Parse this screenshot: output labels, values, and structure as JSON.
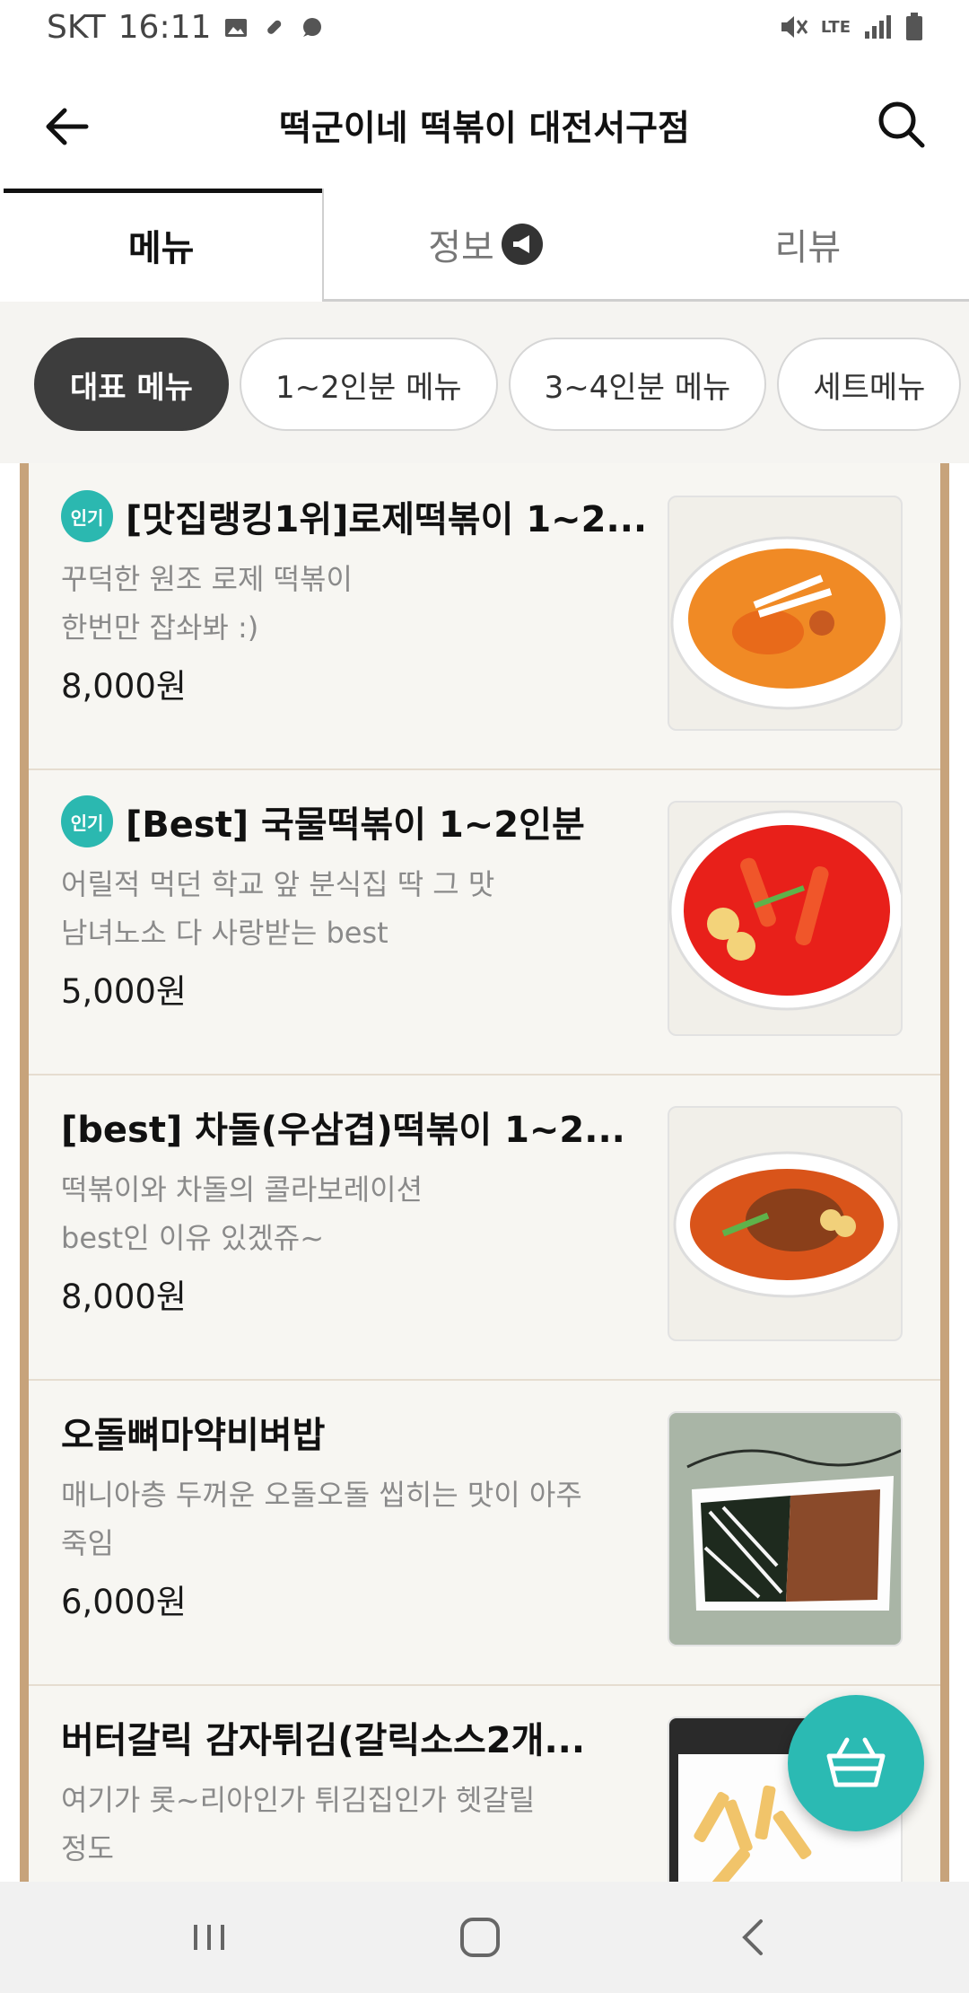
{
  "status_bar": {
    "carrier": "SKT",
    "time": "16:11",
    "network": "LTE"
  },
  "header": {
    "title": "떡군이네 떡볶이 대전서구점"
  },
  "tabs": [
    {
      "label": "메뉴",
      "active": true
    },
    {
      "label": "정보",
      "active": false
    },
    {
      "label": "리뷰",
      "active": false
    }
  ],
  "categories": [
    {
      "label": "대표 메뉴",
      "active": true
    },
    {
      "label": "1~2인분 메뉴"
    },
    {
      "label": "3~4인분 메뉴"
    },
    {
      "label": "세트메뉴"
    }
  ],
  "badge_label": "인기",
  "items": [
    {
      "name": "[맛집랭킹1위]로제떡볶이 1~2...",
      "desc": "꾸덕한 원조 로제 떡볶이\n한번만 잡솨봐 :)",
      "price": "8,000원",
      "popular": true
    },
    {
      "name": "[Best] 국물떡볶이 1~2인분",
      "desc": "어릴적 먹던 학교 앞 분식집 딱 그 맛\n남녀노소 다 사랑받는 best",
      "price": "5,000원",
      "popular": true
    },
    {
      "name": "[best] 차돌(우삼겹)떡볶이 1~2...",
      "desc": "떡볶이와 차돌의 콜라보레이션\nbest인 이유 있겠쥬~",
      "price": "8,000원",
      "popular": false
    },
    {
      "name": "오돌뼈마약비벼밥",
      "desc": "매니아층 두꺼운 오돌오돌 씹히는 맛이 아주\n죽임",
      "price": "6,000원",
      "popular": false
    },
    {
      "name": "버터갈릭 감자튀김(갈릭소스2개...",
      "desc": "여기가 롯~리아인가 튀김집인가 헷갈릴\n정도",
      "price": "",
      "popular": false
    }
  ],
  "colors": {
    "accent": "#2bbab3",
    "frame": "#c7a37b",
    "chip_active": "#3d3d3d"
  }
}
